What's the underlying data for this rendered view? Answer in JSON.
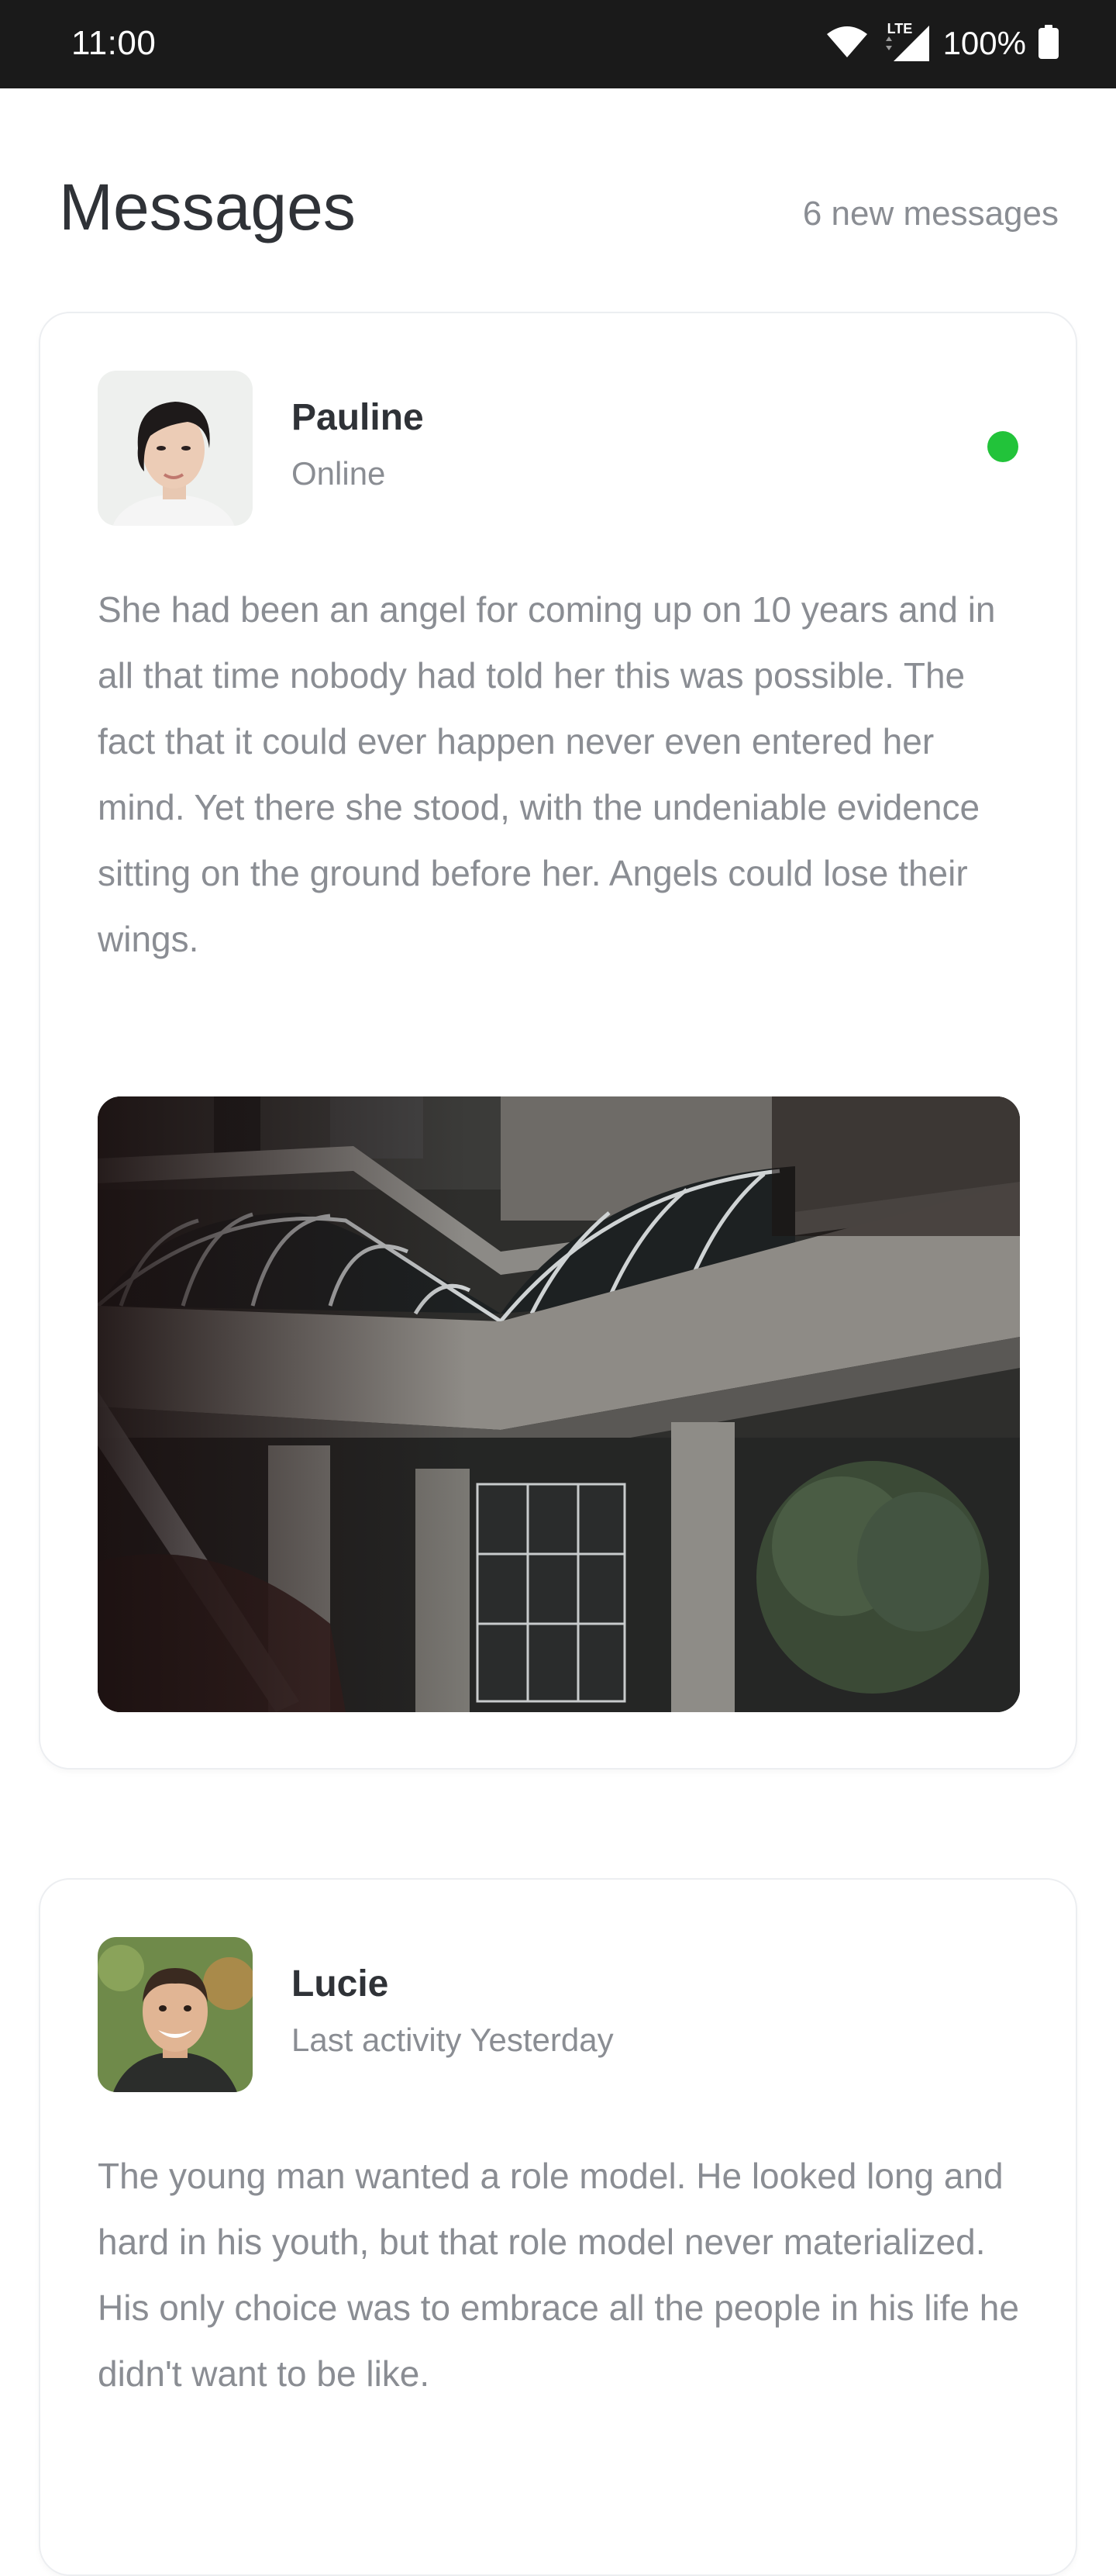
{
  "status_bar": {
    "time": "11:00",
    "network": "LTE",
    "battery": "100%"
  },
  "header": {
    "title": "Messages",
    "new_count": "6 new messages"
  },
  "messages": [
    {
      "name": "Pauline",
      "status": "Online",
      "online": true,
      "text": "She had been an angel for coming up on 10 years and in all that time nobody had told her this was possible. The fact that it could ever happen never even entered her mind. Yet there she stood, with the undeniable evidence sitting on the ground before her. Angels could lose their wings.",
      "has_photo": true
    },
    {
      "name": "Lucie",
      "status": "Last activity Yesterday",
      "online": false,
      "text": "The young man wanted a role model. He looked long and hard in his youth, but that role model never materialized. His only choice was to embrace all the people in his life he didn't want to be like."
    }
  ],
  "colors": {
    "status_bar_bg": "#1a1a1a",
    "title": "#2f3237",
    "muted_text": "#8a8d93",
    "online": "#22c33a",
    "card_border": "#eceef1"
  }
}
